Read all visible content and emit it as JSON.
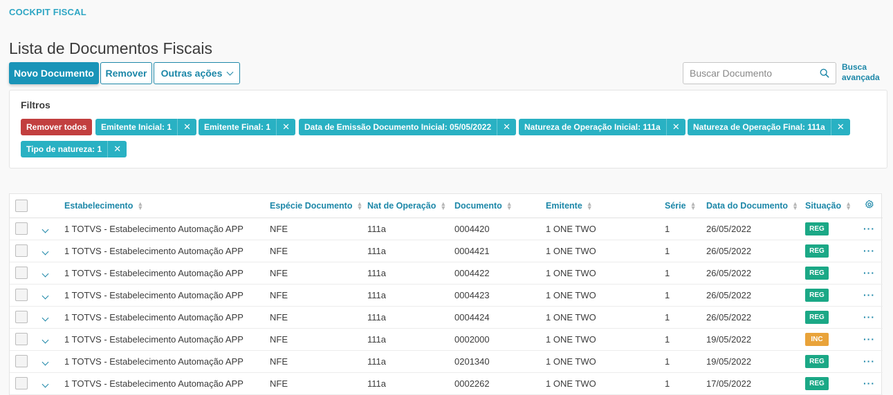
{
  "app": {
    "title": "COCKPIT FISCAL"
  },
  "page": {
    "title": "Lista de Documentos Fiscais"
  },
  "toolbar": {
    "new_label": "Novo Documento",
    "remove_label": "Remover",
    "more_label": "Outras ações"
  },
  "search": {
    "placeholder": "Buscar Documento",
    "advanced_line1": "Busca",
    "advanced_line2": "avançada"
  },
  "filters": {
    "title": "Filtros",
    "remove_all": "Remover todos",
    "chips": [
      "Emitente Inicial: 1",
      "Emitente Final: 1",
      "Data de Emissão Documento Inicial: 05/05/2022",
      "Natureza de Operação Inicial: 111a",
      "Natureza de Operação Final: 111a",
      "Tipo de natureza: 1"
    ]
  },
  "table": {
    "headers": [
      "Estabelecimento",
      "Espécie Documento",
      "Nat de Operação",
      "Documento",
      "Emitente",
      "Série",
      "Data do Documento",
      "Situação"
    ],
    "rows": [
      [
        "1 TOTVS - Estabelecimento Automação APP",
        "NFE",
        "111a",
        "0004420",
        "1 ONE TWO",
        "1",
        "26/05/2022",
        "REG"
      ],
      [
        "1 TOTVS - Estabelecimento Automação APP",
        "NFE",
        "111a",
        "0004421",
        "1 ONE TWO",
        "1",
        "26/05/2022",
        "REG"
      ],
      [
        "1 TOTVS - Estabelecimento Automação APP",
        "NFE",
        "111a",
        "0004422",
        "1 ONE TWO",
        "1",
        "26/05/2022",
        "REG"
      ],
      [
        "1 TOTVS - Estabelecimento Automação APP",
        "NFE",
        "111a",
        "0004423",
        "1 ONE TWO",
        "1",
        "26/05/2022",
        "REG"
      ],
      [
        "1 TOTVS - Estabelecimento Automação APP",
        "NFE",
        "111a",
        "0004424",
        "1 ONE TWO",
        "1",
        "26/05/2022",
        "REG"
      ],
      [
        "1 TOTVS - Estabelecimento Automação APP",
        "NFE",
        "111a",
        "0002000",
        "1 ONE TWO",
        "1",
        "19/05/2022",
        "INC"
      ],
      [
        "1 TOTVS - Estabelecimento Automação APP",
        "NFE",
        "111a",
        "0201340",
        "1 ONE TWO",
        "1",
        "19/05/2022",
        "REG"
      ],
      [
        "1 TOTVS - Estabelecimento Automação APP",
        "NFE",
        "111a",
        "0002262",
        "1 ONE TWO",
        "1",
        "17/05/2022",
        "REG"
      ]
    ],
    "more_glyph": "···"
  },
  "colors": {
    "primary": "#1994b8",
    "link": "#1c87a8",
    "chip": "#29b1c3",
    "danger": "#c23f3f",
    "success": "#1ba886",
    "warning": "#e9a33a"
  },
  "icons": {
    "search": "search-icon",
    "settings": "gear-icon",
    "expand": "chevron-down-icon",
    "row_actions": "more-icon"
  }
}
